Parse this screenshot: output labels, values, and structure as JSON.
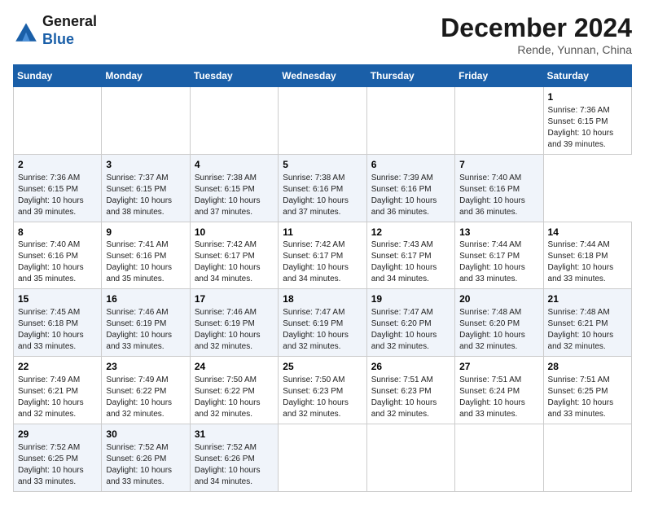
{
  "header": {
    "logo_line1": "General",
    "logo_line2": "Blue",
    "title": "December 2024",
    "location": "Rende, Yunnan, China"
  },
  "calendar": {
    "days_of_week": [
      "Sunday",
      "Monday",
      "Tuesday",
      "Wednesday",
      "Thursday",
      "Friday",
      "Saturday"
    ],
    "weeks": [
      [
        null,
        null,
        null,
        null,
        null,
        null,
        {
          "day": "1",
          "sunrise": "Sunrise: 7:36 AM",
          "sunset": "Sunset: 6:15 PM",
          "daylight": "Daylight: 10 hours and 39 minutes."
        }
      ],
      [
        {
          "day": "2",
          "sunrise": "Sunrise: 7:36 AM",
          "sunset": "Sunset: 6:15 PM",
          "daylight": "Daylight: 10 hours and 39 minutes."
        },
        {
          "day": "3",
          "sunrise": "Sunrise: 7:37 AM",
          "sunset": "Sunset: 6:15 PM",
          "daylight": "Daylight: 10 hours and 38 minutes."
        },
        {
          "day": "4",
          "sunrise": "Sunrise: 7:38 AM",
          "sunset": "Sunset: 6:15 PM",
          "daylight": "Daylight: 10 hours and 37 minutes."
        },
        {
          "day": "5",
          "sunrise": "Sunrise: 7:38 AM",
          "sunset": "Sunset: 6:16 PM",
          "daylight": "Daylight: 10 hours and 37 minutes."
        },
        {
          "day": "6",
          "sunrise": "Sunrise: 7:39 AM",
          "sunset": "Sunset: 6:16 PM",
          "daylight": "Daylight: 10 hours and 36 minutes."
        },
        {
          "day": "7",
          "sunrise": "Sunrise: 7:40 AM",
          "sunset": "Sunset: 6:16 PM",
          "daylight": "Daylight: 10 hours and 36 minutes."
        }
      ],
      [
        {
          "day": "8",
          "sunrise": "Sunrise: 7:40 AM",
          "sunset": "Sunset: 6:16 PM",
          "daylight": "Daylight: 10 hours and 35 minutes."
        },
        {
          "day": "9",
          "sunrise": "Sunrise: 7:41 AM",
          "sunset": "Sunset: 6:16 PM",
          "daylight": "Daylight: 10 hours and 35 minutes."
        },
        {
          "day": "10",
          "sunrise": "Sunrise: 7:42 AM",
          "sunset": "Sunset: 6:17 PM",
          "daylight": "Daylight: 10 hours and 34 minutes."
        },
        {
          "day": "11",
          "sunrise": "Sunrise: 7:42 AM",
          "sunset": "Sunset: 6:17 PM",
          "daylight": "Daylight: 10 hours and 34 minutes."
        },
        {
          "day": "12",
          "sunrise": "Sunrise: 7:43 AM",
          "sunset": "Sunset: 6:17 PM",
          "daylight": "Daylight: 10 hours and 34 minutes."
        },
        {
          "day": "13",
          "sunrise": "Sunrise: 7:44 AM",
          "sunset": "Sunset: 6:17 PM",
          "daylight": "Daylight: 10 hours and 33 minutes."
        },
        {
          "day": "14",
          "sunrise": "Sunrise: 7:44 AM",
          "sunset": "Sunset: 6:18 PM",
          "daylight": "Daylight: 10 hours and 33 minutes."
        }
      ],
      [
        {
          "day": "15",
          "sunrise": "Sunrise: 7:45 AM",
          "sunset": "Sunset: 6:18 PM",
          "daylight": "Daylight: 10 hours and 33 minutes."
        },
        {
          "day": "16",
          "sunrise": "Sunrise: 7:46 AM",
          "sunset": "Sunset: 6:19 PM",
          "daylight": "Daylight: 10 hours and 33 minutes."
        },
        {
          "day": "17",
          "sunrise": "Sunrise: 7:46 AM",
          "sunset": "Sunset: 6:19 PM",
          "daylight": "Daylight: 10 hours and 32 minutes."
        },
        {
          "day": "18",
          "sunrise": "Sunrise: 7:47 AM",
          "sunset": "Sunset: 6:19 PM",
          "daylight": "Daylight: 10 hours and 32 minutes."
        },
        {
          "day": "19",
          "sunrise": "Sunrise: 7:47 AM",
          "sunset": "Sunset: 6:20 PM",
          "daylight": "Daylight: 10 hours and 32 minutes."
        },
        {
          "day": "20",
          "sunrise": "Sunrise: 7:48 AM",
          "sunset": "Sunset: 6:20 PM",
          "daylight": "Daylight: 10 hours and 32 minutes."
        },
        {
          "day": "21",
          "sunrise": "Sunrise: 7:48 AM",
          "sunset": "Sunset: 6:21 PM",
          "daylight": "Daylight: 10 hours and 32 minutes."
        }
      ],
      [
        {
          "day": "22",
          "sunrise": "Sunrise: 7:49 AM",
          "sunset": "Sunset: 6:21 PM",
          "daylight": "Daylight: 10 hours and 32 minutes."
        },
        {
          "day": "23",
          "sunrise": "Sunrise: 7:49 AM",
          "sunset": "Sunset: 6:22 PM",
          "daylight": "Daylight: 10 hours and 32 minutes."
        },
        {
          "day": "24",
          "sunrise": "Sunrise: 7:50 AM",
          "sunset": "Sunset: 6:22 PM",
          "daylight": "Daylight: 10 hours and 32 minutes."
        },
        {
          "day": "25",
          "sunrise": "Sunrise: 7:50 AM",
          "sunset": "Sunset: 6:23 PM",
          "daylight": "Daylight: 10 hours and 32 minutes."
        },
        {
          "day": "26",
          "sunrise": "Sunrise: 7:51 AM",
          "sunset": "Sunset: 6:23 PM",
          "daylight": "Daylight: 10 hours and 32 minutes."
        },
        {
          "day": "27",
          "sunrise": "Sunrise: 7:51 AM",
          "sunset": "Sunset: 6:24 PM",
          "daylight": "Daylight: 10 hours and 33 minutes."
        },
        {
          "day": "28",
          "sunrise": "Sunrise: 7:51 AM",
          "sunset": "Sunset: 6:25 PM",
          "daylight": "Daylight: 10 hours and 33 minutes."
        }
      ],
      [
        {
          "day": "29",
          "sunrise": "Sunrise: 7:52 AM",
          "sunset": "Sunset: 6:25 PM",
          "daylight": "Daylight: 10 hours and 33 minutes."
        },
        {
          "day": "30",
          "sunrise": "Sunrise: 7:52 AM",
          "sunset": "Sunset: 6:26 PM",
          "daylight": "Daylight: 10 hours and 33 minutes."
        },
        {
          "day": "31",
          "sunrise": "Sunrise: 7:52 AM",
          "sunset": "Sunset: 6:26 PM",
          "daylight": "Daylight: 10 hours and 34 minutes."
        },
        null,
        null,
        null,
        null
      ]
    ]
  }
}
